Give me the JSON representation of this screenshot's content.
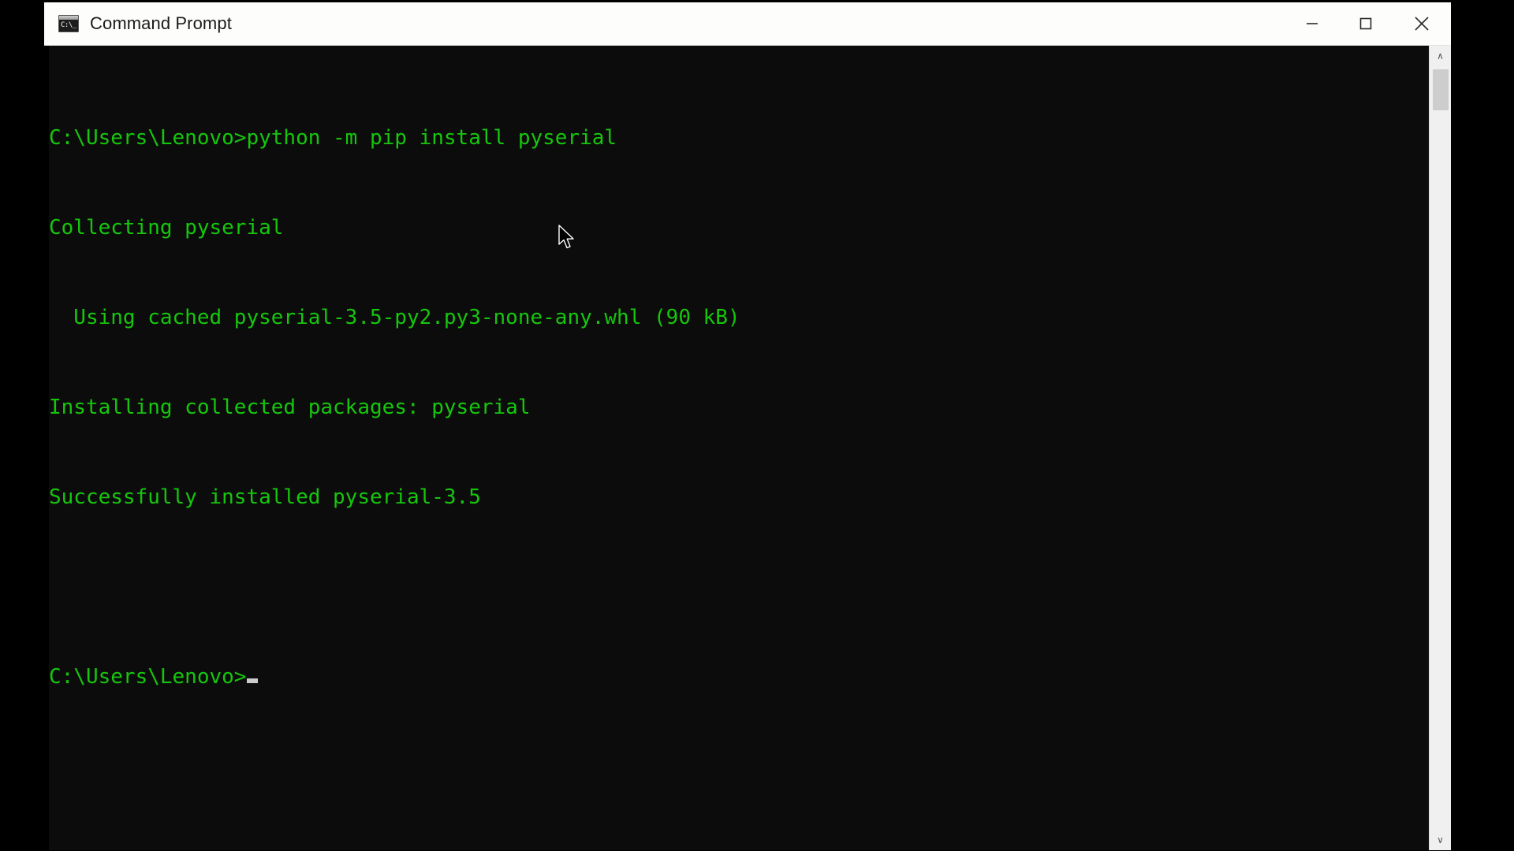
{
  "window": {
    "title": "Command Prompt",
    "icon_name": "command-prompt-icon",
    "icon_text": "C:\\_",
    "controls": {
      "minimize_label": "Minimize",
      "maximize_label": "Maximize",
      "close_label": "Close"
    }
  },
  "terminal": {
    "foreground_color": "#16c60c",
    "background_color": "#0c0c0c",
    "lines": [
      "C:\\Users\\Lenovo>python -m pip install pyserial",
      "Collecting pyserial",
      "  Using cached pyserial-3.5-py2.py3-none-any.whl (90 kB)",
      "Installing collected packages: pyserial",
      "Successfully installed pyserial-3.5",
      "",
      "C:\\Users\\Lenovo>"
    ],
    "prompt_line": "C:\\Users\\Lenovo>",
    "cursor_visible": true
  },
  "scrollbar": {
    "up_arrow_glyph": "∧",
    "down_arrow_glyph": "∨",
    "thumb_position_percent": 0
  }
}
